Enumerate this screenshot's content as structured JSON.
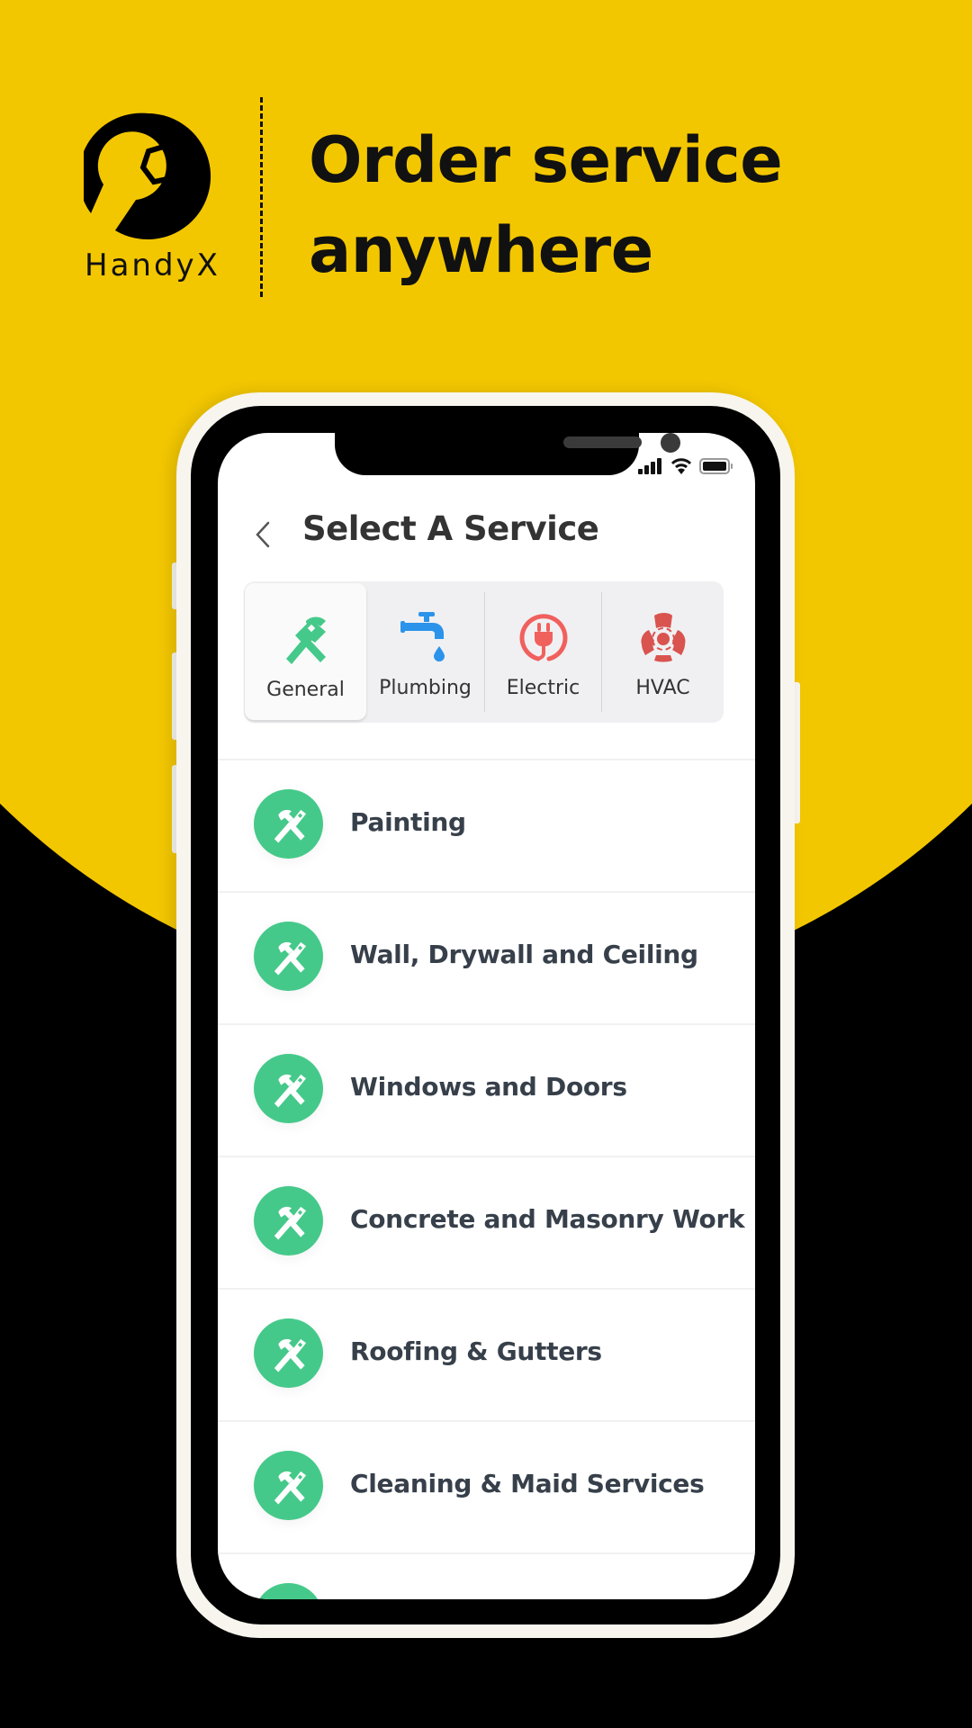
{
  "promo": {
    "brand_name": "HandyX",
    "headline_line1": "Order service",
    "headline_line2": "anywhere"
  },
  "colors": {
    "brand_yellow": "#f3c700",
    "accent_green": "#45c98a",
    "plumbing_blue": "#2b93ea",
    "electric_red": "#f0605d",
    "hvac_red": "#d9534f"
  },
  "status_bar": {
    "icons": [
      "signal-icon",
      "wifi-icon",
      "battery-icon"
    ]
  },
  "header": {
    "back_icon": "chevron-left-icon",
    "title": "Select A Service"
  },
  "categories": [
    {
      "label": "General",
      "icon": "hammer-saw-icon",
      "selected": true
    },
    {
      "label": "Plumbing",
      "icon": "faucet-icon",
      "selected": false
    },
    {
      "label": "Electric",
      "icon": "plug-icon",
      "selected": false
    },
    {
      "label": "HVAC",
      "icon": "fan-icon",
      "selected": false
    }
  ],
  "services": [
    {
      "name": "Painting",
      "icon": "hammer-saw-icon"
    },
    {
      "name": "Wall, Drywall and Ceiling",
      "icon": "hammer-saw-icon"
    },
    {
      "name": "Windows and Doors",
      "icon": "hammer-saw-icon"
    },
    {
      "name": "Concrete and Masonry Work",
      "icon": "hammer-saw-icon"
    },
    {
      "name": "Roofing & Gutters",
      "icon": "hammer-saw-icon"
    },
    {
      "name": "Cleaning & Maid Services",
      "icon": "hammer-saw-icon"
    },
    {
      "name": "",
      "icon": "hammer-saw-icon"
    }
  ]
}
